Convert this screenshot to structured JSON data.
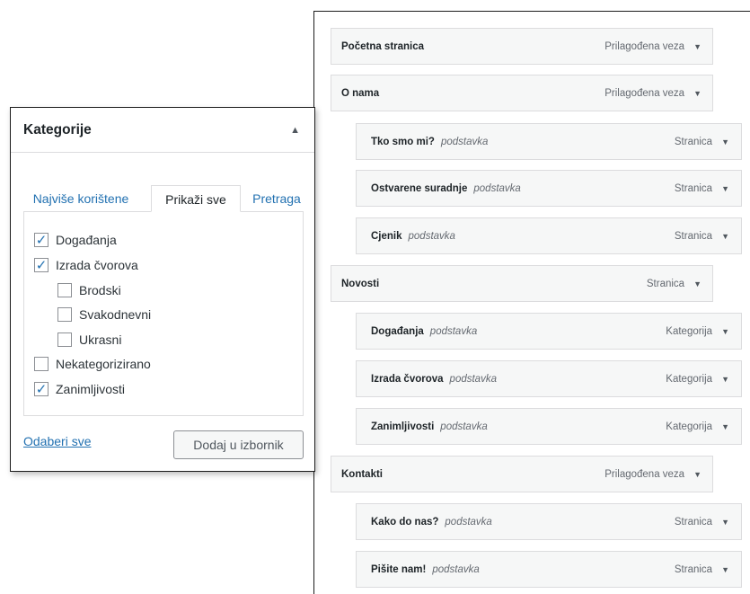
{
  "categories_panel": {
    "title": "Kategorije",
    "toggle_icon": "triangle-up-icon",
    "tabs": {
      "most_used": "Najviše korištene",
      "show_all": "Prikaži sve",
      "search": "Pretraga"
    },
    "items": [
      {
        "label": "Događanja",
        "checked": true
      },
      {
        "label": "Izrada čvorova",
        "checked": true
      },
      {
        "label": "Brodski",
        "checked": false
      },
      {
        "label": "Svakodnevni",
        "checked": false
      },
      {
        "label": "Ukrasni",
        "checked": false
      },
      {
        "label": "Nekategorizirano",
        "checked": false
      },
      {
        "label": "Zanimljivosti",
        "checked": true
      }
    ],
    "select_all": "Odaberi sve",
    "add_button": "Dodaj u izbornik"
  },
  "menu_structure": {
    "items": [
      {
        "title": "Početna stranica",
        "subtitle": "",
        "type": "Prilagođena veza"
      },
      {
        "title": "O nama",
        "subtitle": "",
        "type": "Prilagođena veza"
      },
      {
        "title": "Tko smo mi?",
        "subtitle": "podstavka",
        "type": "Stranica"
      },
      {
        "title": "Ostvarene suradnje",
        "subtitle": "podstavka",
        "type": "Stranica"
      },
      {
        "title": "Cjenik",
        "subtitle": "podstavka",
        "type": "Stranica"
      },
      {
        "title": "Novosti",
        "subtitle": "",
        "type": "Stranica"
      },
      {
        "title": "Događanja",
        "subtitle": "podstavka",
        "type": "Kategorija"
      },
      {
        "title": "Izrada čvorova",
        "subtitle": "podstavka",
        "type": "Kategorija"
      },
      {
        "title": "Zanimljivosti",
        "subtitle": "podstavka",
        "type": "Kategorija"
      },
      {
        "title": "Kontakti",
        "subtitle": "",
        "type": "Prilagođena veza"
      },
      {
        "title": "Kako do nas?",
        "subtitle": "podstavka",
        "type": "Stranica"
      },
      {
        "title": "Pišite nam!",
        "subtitle": "podstavka",
        "type": "Stranica"
      }
    ],
    "expand_icon": "triangle-down-icon"
  },
  "colors": {
    "link": "#2271b1",
    "item_bg": "#f6f7f7",
    "border": "#dcdcde"
  }
}
